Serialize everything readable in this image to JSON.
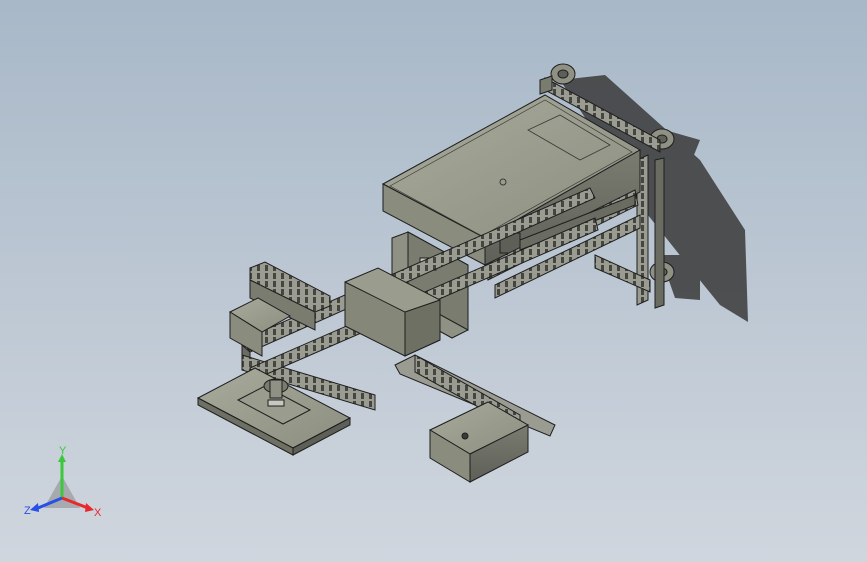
{
  "viewport": {
    "background_top": "#a8b8c8",
    "background_bottom": "#d0d6de"
  },
  "model": {
    "part_color": "#8f9184",
    "edge_color": "#1e1e1e",
    "frame_color": "#9a9c92"
  },
  "triad": {
    "x_label": "X",
    "y_label": "Y",
    "z_label": "Z",
    "x_color": "#e8282c",
    "y_color": "#3cc83c",
    "z_color": "#2850e6"
  }
}
